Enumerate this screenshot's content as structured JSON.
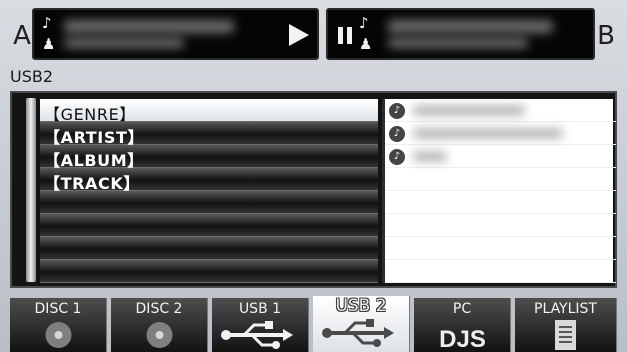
{
  "deck_a": {
    "letter": "A",
    "note_icon": "music-note-icon",
    "person_icon": "person-icon",
    "play_icon": "play-icon"
  },
  "deck_b": {
    "letter": "B",
    "pause_icon": "pause-icon",
    "note_icon": "music-note-icon",
    "person_icon": "person-icon"
  },
  "source_title": "USB2",
  "browser": {
    "items": [
      {
        "label": "【GENRE】",
        "selected": true
      },
      {
        "label": "【ARTIST】",
        "selected": false
      },
      {
        "label": "【ALBUM】",
        "selected": false
      },
      {
        "label": "【TRACK】",
        "selected": false
      }
    ],
    "preview_icon": "genre-icon"
  },
  "tabs": [
    {
      "label": "DISC 1",
      "icon": "disc-icon",
      "active": false
    },
    {
      "label": "DISC 2",
      "icon": "disc-icon",
      "active": false
    },
    {
      "label": "USB 1",
      "icon": "usb-icon",
      "active": false
    },
    {
      "label": "USB 2",
      "icon": "usb-icon",
      "active": true
    },
    {
      "label": "PC",
      "icon": "djs-icon",
      "icon_text": "DJS",
      "active": false
    },
    {
      "label": "PLAYLIST",
      "icon": "playlist-icon",
      "active": false
    }
  ],
  "colors": {
    "accent": "#ffffff",
    "dark": "#141414",
    "panel": "#050505"
  }
}
